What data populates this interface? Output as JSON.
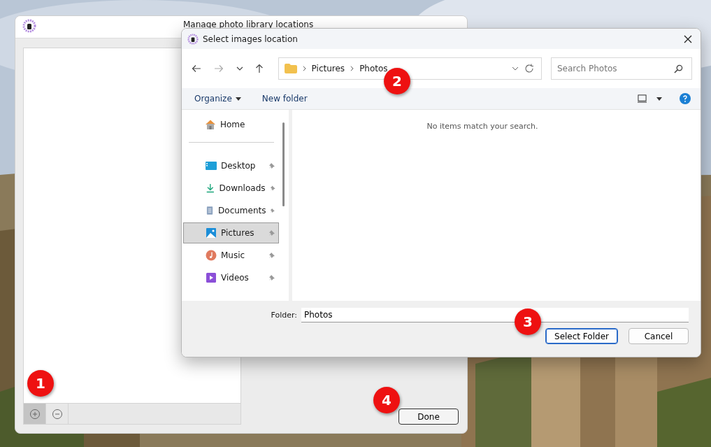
{
  "main_window": {
    "title": "Manage photo library locations",
    "list_buttons": [
      {
        "kind": "add",
        "selected": true
      },
      {
        "kind": "remove",
        "selected": false
      }
    ],
    "done_button": "Done"
  },
  "dialog": {
    "title": "Select images location",
    "breadcrumb": [
      "Pictures",
      "Photos"
    ],
    "search": {
      "placeholder": "Search Photos"
    },
    "organize": "Organize",
    "new_folder": "New folder",
    "home": "Home",
    "nav_items": [
      {
        "label": "Desktop",
        "kind": "desktop",
        "selected": false
      },
      {
        "label": "Downloads",
        "kind": "downloads",
        "selected": false
      },
      {
        "label": "Documents",
        "kind": "documents",
        "selected": false
      },
      {
        "label": "Pictures",
        "kind": "pictures",
        "selected": true
      },
      {
        "label": "Music",
        "kind": "music",
        "selected": false
      },
      {
        "label": "Videos",
        "kind": "videos",
        "selected": false
      }
    ],
    "empty_message": "No items match your search.",
    "folder": {
      "label": "Folder:",
      "value": "Photos"
    },
    "buttons": [
      "Select Folder",
      "Cancel"
    ]
  },
  "callouts": [
    "1",
    "2",
    "3",
    "4"
  ]
}
